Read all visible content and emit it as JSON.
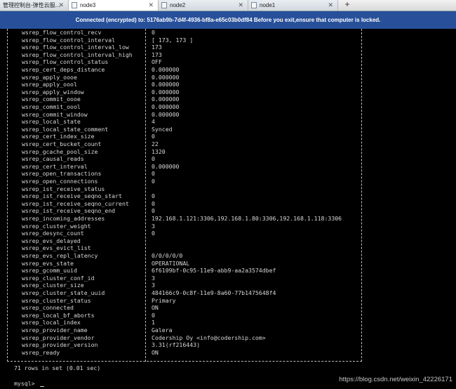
{
  "tabs": [
    {
      "label": "管理控制台-弹性云服...",
      "active": false
    },
    {
      "label": "node3",
      "active": true
    },
    {
      "label": "node2",
      "active": false
    },
    {
      "label": "node1",
      "active": false
    }
  ],
  "new_tab_label": "+",
  "banner": "Connected (encrypted) to: 5176ab9b-7d4f-4936-bf8a-e65c03b0df84 Before you exit,ensure that computer is locked.",
  "status_rows": [
    {
      "name": "wsrep_flow_control_recv",
      "value": "0"
    },
    {
      "name": "wsrep_flow_control_interval",
      "value": "[ 173, 173 ]"
    },
    {
      "name": "wsrep_flow_control_interval_low",
      "value": "173"
    },
    {
      "name": "wsrep_flow_control_interval_high",
      "value": "173"
    },
    {
      "name": "wsrep_flow_control_status",
      "value": "OFF"
    },
    {
      "name": "wsrep_cert_deps_distance",
      "value": "0.000000"
    },
    {
      "name": "wsrep_apply_oooe",
      "value": "0.000000"
    },
    {
      "name": "wsrep_apply_oool",
      "value": "0.000000"
    },
    {
      "name": "wsrep_apply_window",
      "value": "0.000000"
    },
    {
      "name": "wsrep_commit_oooe",
      "value": "0.000000"
    },
    {
      "name": "wsrep_commit_oool",
      "value": "0.000000"
    },
    {
      "name": "wsrep_commit_window",
      "value": "0.000000"
    },
    {
      "name": "wsrep_local_state",
      "value": "4"
    },
    {
      "name": "wsrep_local_state_comment",
      "value": "Synced"
    },
    {
      "name": "wsrep_cert_index_size",
      "value": "0"
    },
    {
      "name": "wsrep_cert_bucket_count",
      "value": "22"
    },
    {
      "name": "wsrep_gcache_pool_size",
      "value": "1320"
    },
    {
      "name": "wsrep_causal_reads",
      "value": "0"
    },
    {
      "name": "wsrep_cert_interval",
      "value": "0.000000"
    },
    {
      "name": "wsrep_open_transactions",
      "value": "0"
    },
    {
      "name": "wsrep_open_connections",
      "value": "0"
    },
    {
      "name": "wsrep_ist_receive_status",
      "value": ""
    },
    {
      "name": "wsrep_ist_receive_seqno_start",
      "value": "0"
    },
    {
      "name": "wsrep_ist_receive_seqno_current",
      "value": "0"
    },
    {
      "name": "wsrep_ist_receive_seqno_end",
      "value": "0"
    },
    {
      "name": "wsrep_incoming_addresses",
      "value": "192.168.1.121:3306,192.168.1.80:3306,192.168.1.118:3306"
    },
    {
      "name": "wsrep_cluster_weight",
      "value": "3"
    },
    {
      "name": "wsrep_desync_count",
      "value": "0"
    },
    {
      "name": "wsrep_evs_delayed",
      "value": ""
    },
    {
      "name": "wsrep_evs_evict_list",
      "value": ""
    },
    {
      "name": "wsrep_evs_repl_latency",
      "value": "0/0/0/0/0"
    },
    {
      "name": "wsrep_evs_state",
      "value": "OPERATIONAL"
    },
    {
      "name": "wsrep_gcomm_uuid",
      "value": "6f6109bf-0c95-11e9-abb9-aa2a3574dbef"
    },
    {
      "name": "wsrep_cluster_conf_id",
      "value": "3"
    },
    {
      "name": "wsrep_cluster_size",
      "value": "3"
    },
    {
      "name": "wsrep_cluster_state_uuid",
      "value": "484166c9-0c8f-11e9-8a60-77b1475648f4"
    },
    {
      "name": "wsrep_cluster_status",
      "value": "Primary"
    },
    {
      "name": "wsrep_connected",
      "value": "ON"
    },
    {
      "name": "wsrep_local_bf_aborts",
      "value": "0"
    },
    {
      "name": "wsrep_local_index",
      "value": "1"
    },
    {
      "name": "wsrep_provider_name",
      "value": "Galera"
    },
    {
      "name": "wsrep_provider_vendor",
      "value": "Codership Oy <info@codership.com>"
    },
    {
      "name": "wsrep_provider_version",
      "value": "3.31(rf216443)"
    },
    {
      "name": "wsrep_ready",
      "value": "ON"
    }
  ],
  "summary": "71 rows in set (0.01 sec)",
  "prompt": "mysql> ",
  "watermark": "https://blog.csdn.net/weixin_42226171"
}
